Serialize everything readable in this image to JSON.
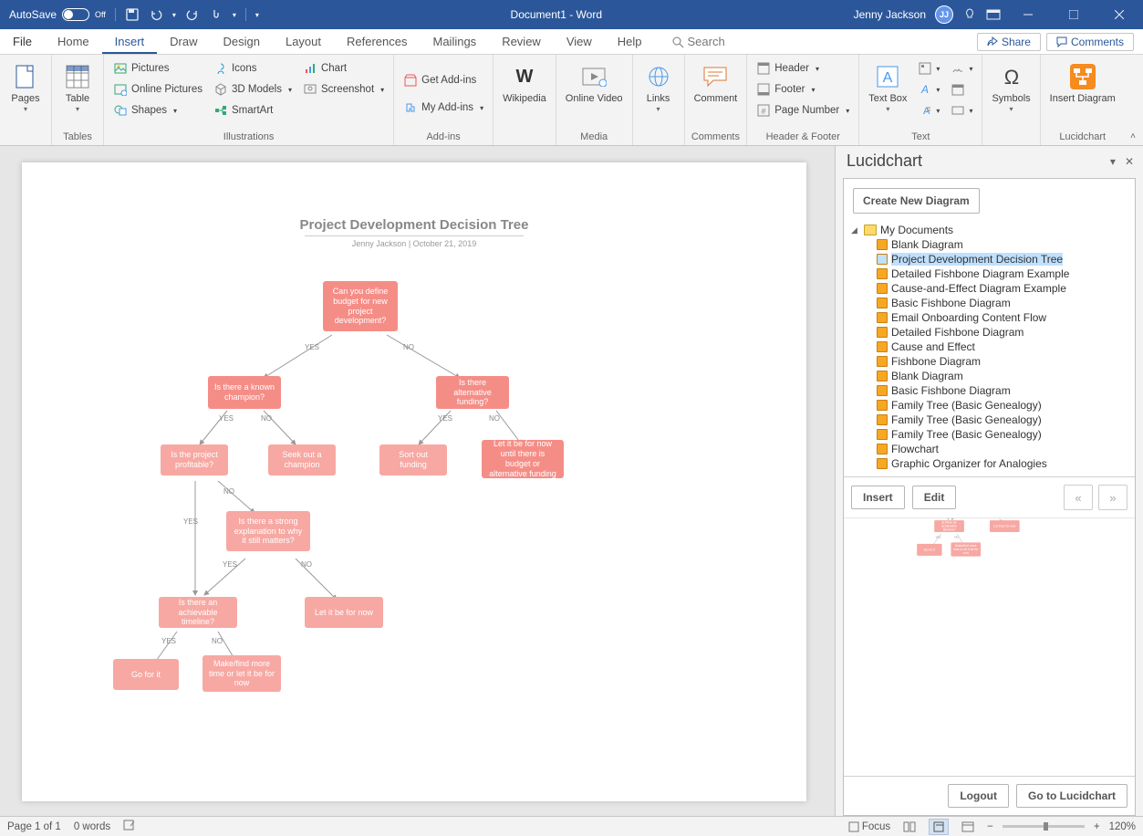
{
  "titlebar": {
    "autosave": "AutoSave",
    "autosave_state": "Off",
    "document": "Document1  -  Word",
    "user": "Jenny Jackson",
    "user_initials": "JJ"
  },
  "menu": {
    "file": "File",
    "home": "Home",
    "insert": "Insert",
    "draw": "Draw",
    "design": "Design",
    "layout": "Layout",
    "references": "References",
    "mailings": "Mailings",
    "review": "Review",
    "view": "View",
    "help": "Help",
    "search": "Search",
    "share": "Share",
    "comments": "Comments"
  },
  "ribbon": {
    "pages": "Pages",
    "table": "Table",
    "tables": "Tables",
    "pictures": "Pictures",
    "online_pictures": "Online Pictures",
    "shapes": "Shapes",
    "icons": "Icons",
    "models": "3D Models",
    "smartart": "SmartArt",
    "chart": "Chart",
    "screenshot": "Screenshot",
    "illustrations": "Illustrations",
    "get_addins": "Get Add-ins",
    "my_addins": "My Add-ins",
    "addins": "Add-ins",
    "wikipedia": "Wikipedia",
    "online_video": "Online Video",
    "media": "Media",
    "links": "Links",
    "comment": "Comment",
    "comments": "Comments",
    "header": "Header",
    "footer": "Footer",
    "page_number": "Page Number",
    "header_footer": "Header & Footer",
    "text_box": "Text Box",
    "text": "Text",
    "symbols": "Symbols",
    "insert_diagram": "Insert Diagram",
    "lucidchart": "Lucidchart"
  },
  "doc": {
    "title": "Project Development Decision Tree",
    "subtitle": "Jenny Jackson  |  October 21, 2019",
    "n1": "Can you define budget for new project development?",
    "n2": "Is there a known champion?",
    "n3": "Is there alternative funding?",
    "n4": "Is the project profitable?",
    "n5": "Seek out a champion",
    "n6": "Sort out funding",
    "n7": "Let it be for now until there is budget or alternative funding",
    "n8": "Is there a strong explanation to why it still matters?",
    "n9": "Is there an achievable timeline?",
    "n10": "Let it be for now",
    "n11": "Go for it",
    "n12": "Make/find more time or let it be for now",
    "yes": "YES",
    "no": "NO"
  },
  "lucid": {
    "title": "Lucidchart",
    "create": "Create New Diagram",
    "root": "My Documents",
    "items": [
      "Blank Diagram",
      "Project Development Decision Tree",
      "Detailed Fishbone Diagram Example",
      "Cause-and-Effect Diagram Example",
      "Basic Fishbone Diagram",
      "Email Onboarding Content Flow",
      "Detailed Fishbone Diagram",
      "Cause and Effect",
      "Fishbone Diagram",
      "Blank Diagram",
      "Basic Fishbone Diagram",
      "Family Tree (Basic Genealogy)",
      "Family Tree (Basic Genealogy)",
      "Family Tree (Basic Genealogy)",
      "Flowchart",
      "Graphic Organizer for Analogies"
    ],
    "selected_index": 1,
    "insert": "Insert",
    "edit": "Edit",
    "logout": "Logout",
    "goto": "Go to Lucidchart"
  },
  "status": {
    "page": "Page 1 of 1",
    "words": "0 words",
    "focus": "Focus",
    "zoom": "120%"
  }
}
